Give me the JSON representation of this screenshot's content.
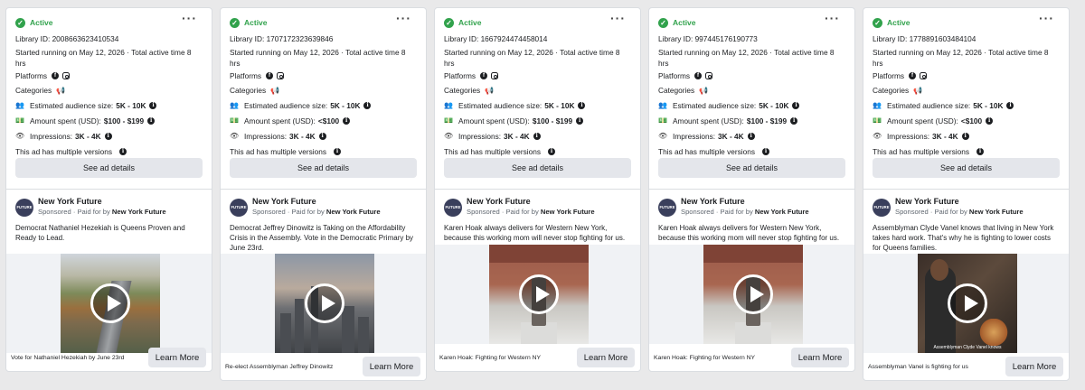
{
  "ui": {
    "active_label": "Active",
    "more_icon": "more-horizontal-icon",
    "platforms_label": "Platforms",
    "categories_label": "Categories",
    "audience_label": "Estimated audience size:",
    "spent_label": "Amount spent (USD):",
    "impressions_label": "Impressions:",
    "versions_label": "This ad has multiple versions",
    "details_button": "See ad details",
    "sponsored_prefix": "Sponsored · Paid for by",
    "learn_more": "Learn More",
    "status_color": "#31a24c"
  },
  "cards": [
    {
      "library_id": "Library ID: 2008663623410534",
      "started": "Started running on May 12, 2026 · Total active time 8 hrs",
      "audience": "5K - 10K",
      "spent": "$100 - $199",
      "impressions": "3K - 4K",
      "advertiser": "New York Future",
      "paid_by": "New York Future",
      "avatar_text": "FUTURE",
      "ad_text": "Democrat Nathaniel Hezekiah is Queens Proven and Ready to Lead.",
      "media_caption": "",
      "footer_caption": "Vote for Nathaniel Hezekiah by June 23rd"
    },
    {
      "library_id": "Library ID: 1707172323639846",
      "started": "Started running on May 12, 2026 · Total active time 8 hrs",
      "audience": "5K - 10K",
      "spent": "<$100",
      "impressions": "3K - 4K",
      "advertiser": "New York Future",
      "paid_by": "New York Future",
      "avatar_text": "FUTURE",
      "ad_text": "Democrat Jeffrey Dinowitz is Taking on the Affordability Crisis in the Assembly. Vote in the Democratic Primary by June 23rd.",
      "media_caption": "",
      "footer_caption": "Re-elect Assemblyman Jeffrey Dinowitz"
    },
    {
      "library_id": "Library ID: 1667924474458014",
      "started": "Started running on May 12, 2026 · Total active time 8 hrs",
      "audience": "5K - 10K",
      "spent": "$100 - $199",
      "impressions": "3K - 4K",
      "advertiser": "New York Future",
      "paid_by": "New York Future",
      "avatar_text": "FUTURE",
      "ad_text": "Karen Hoak always delivers for Western New York, because this working mom will never stop fighting for us.",
      "media_caption": "",
      "footer_caption": "Karen Hoak: Fighting for Western NY"
    },
    {
      "library_id": "Library ID: 997445176190773",
      "started": "Started running on May 12, 2026 · Total active time 8 hrs",
      "audience": "5K - 10K",
      "spent": "$100 - $199",
      "impressions": "3K - 4K",
      "advertiser": "New York Future",
      "paid_by": "New York Future",
      "avatar_text": "FUTURE",
      "ad_text": "Karen Hoak always delivers for Western New York, because this working mom will never stop fighting for us.",
      "media_caption": "",
      "footer_caption": "Karen Hoak: Fighting for Western NY"
    },
    {
      "library_id": "Library ID: 1778891603484104",
      "started": "Started running on May 12, 2026 · Total active time 8 hrs",
      "audience": "5K - 10K",
      "spent": "<$100",
      "impressions": "3K - 4K",
      "advertiser": "New York Future",
      "paid_by": "New York Future",
      "avatar_text": "FUTURE",
      "ad_text": "Assemblyman Clyde Vanel knows that living in New York takes hard work. That's why he is fighting to lower costs for Queens families.",
      "media_caption": "Assemblyman Clyde Vanel knows",
      "footer_caption": "Assemblyman Vanel is fighting for us"
    }
  ]
}
